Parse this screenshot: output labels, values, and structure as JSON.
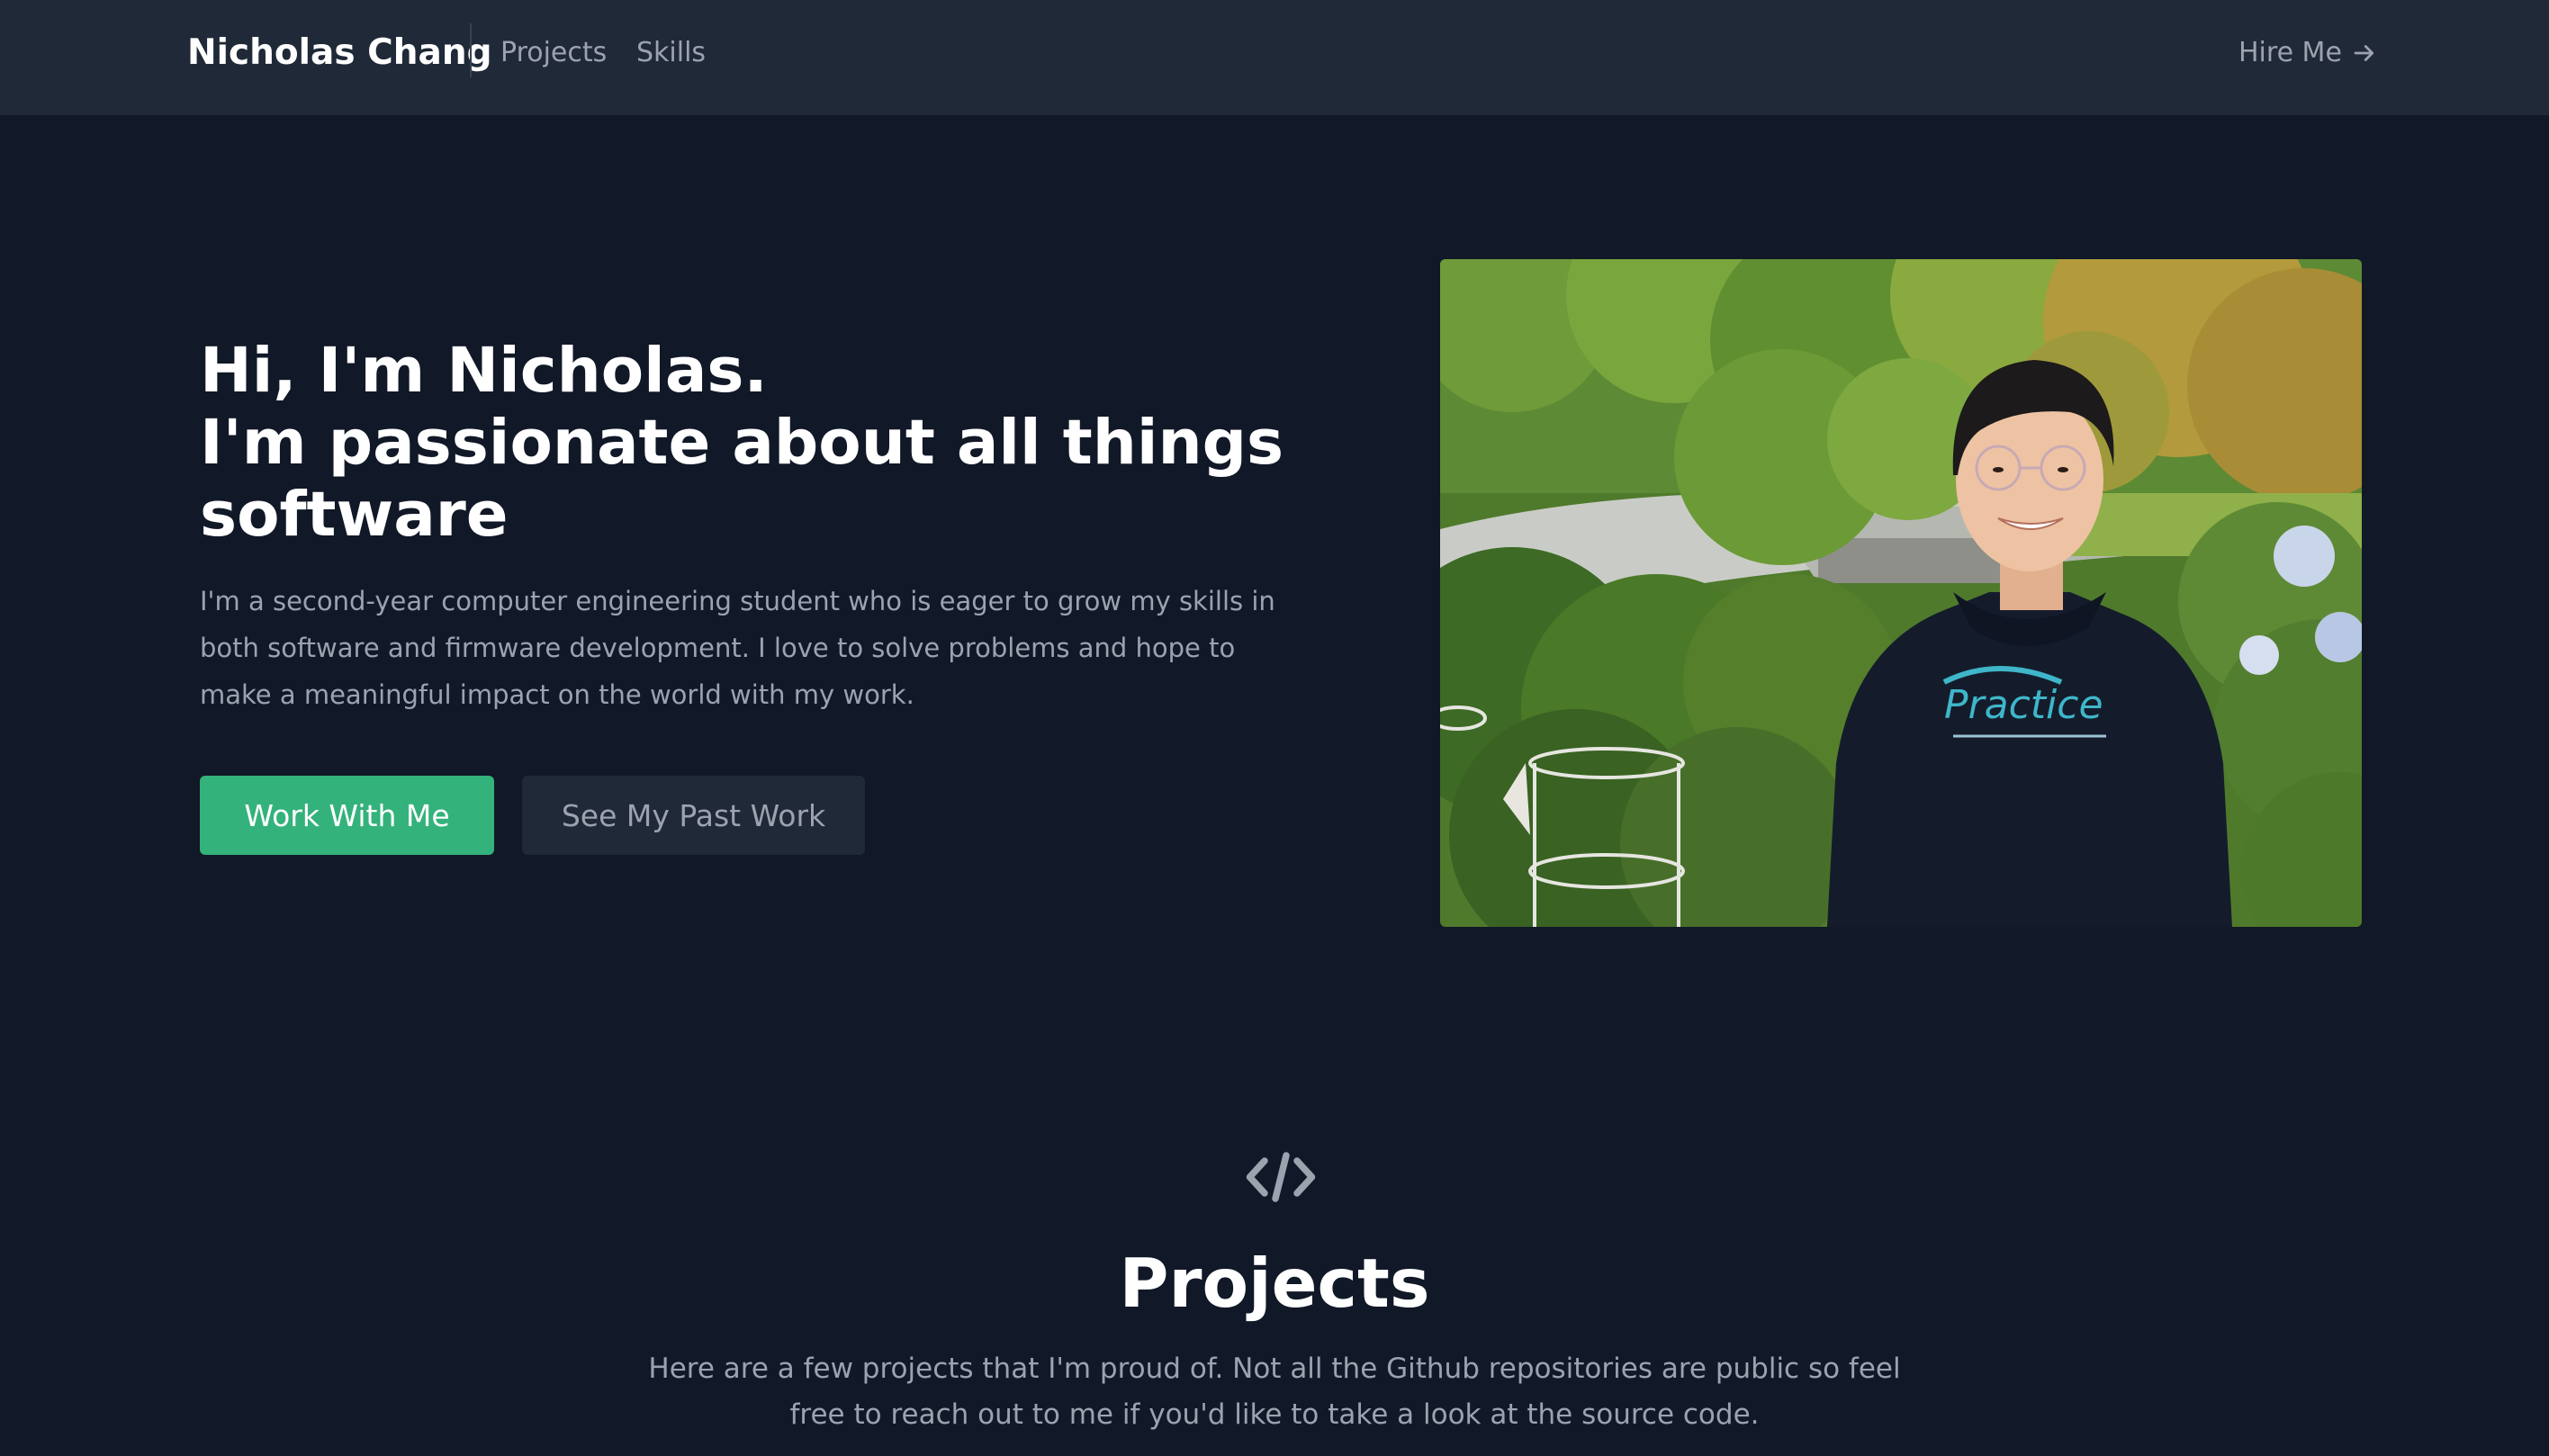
{
  "nav": {
    "brand": "Nicholas Chang",
    "links": [
      "Projects",
      "Skills"
    ],
    "hire_me": "Hire Me",
    "hire_me_icon": "arrow-right-icon"
  },
  "hero": {
    "title_lines": [
      "Hi, I'm Nicholas.",
      "I'm passionate about all things",
      "software"
    ],
    "description_lines": [
      "I'm a second-year computer engineering student who is eager to grow my skills in",
      "both software and firmware development. I love to solve problems and hope to",
      "make a meaningful impact on the world with my work."
    ],
    "primary_button": "Work With Me",
    "secondary_button": "See My Past Work",
    "photo_hoodie_text": "Practice"
  },
  "projects": {
    "icon": "code-icon",
    "title": "Projects",
    "description_lines": [
      "Here are a few projects that I'm proud of. Not all the Github repositories are public so feel",
      "free to reach out to me if you'd like to take a look at the source code."
    ]
  },
  "colors": {
    "background": "#111827",
    "navbar": "#1f2937",
    "accent": "#34b27b",
    "muted_text": "#9ca3af",
    "heading_text": "#ffffff"
  }
}
